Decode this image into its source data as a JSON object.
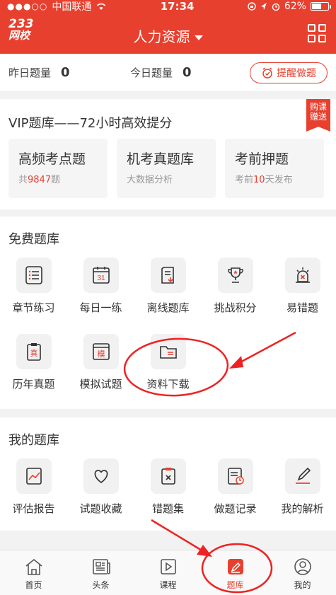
{
  "status_bar": {
    "signal": "●●●○○",
    "carrier": "中国联通",
    "time": "17:34",
    "battery": "62%",
    "battery_level": 0.62
  },
  "header": {
    "logo_num": "233",
    "logo_text": "网校",
    "title": "人力资源"
  },
  "stats": {
    "yesterday_label": "昨日题量",
    "yesterday_value": "0",
    "today_label": "今日题量",
    "today_value": "0",
    "remind_label": "提醒做题"
  },
  "vip": {
    "title": "VIP题库——72小时高效提分",
    "badge_line1": "购课",
    "badge_line2": "赠送",
    "cards": [
      {
        "title": "高频考点题",
        "sub_prefix": "共",
        "sub_highlight": "9847",
        "sub_suffix": "题"
      },
      {
        "title": "机考真题库",
        "sub_prefix": "大数据分析",
        "sub_highlight": "",
        "sub_suffix": ""
      },
      {
        "title": "考前押题",
        "sub_prefix": "考前",
        "sub_highlight": "10",
        "sub_suffix": "天发布"
      }
    ]
  },
  "free_bank": {
    "title": "免费题库",
    "items": [
      {
        "label": "章节练习",
        "icon": "list-icon"
      },
      {
        "label": "每日一练",
        "icon": "calendar-icon",
        "icon_text": "31"
      },
      {
        "label": "离线题库",
        "icon": "download-doc-icon"
      },
      {
        "label": "挑战积分",
        "icon": "trophy-icon"
      },
      {
        "label": "易错题",
        "icon": "alarm-icon"
      },
      {
        "label": "历年真题",
        "icon": "clipboard-icon",
        "icon_text": "真"
      },
      {
        "label": "模拟试题",
        "icon": "browser-icon",
        "icon_text": "模"
      },
      {
        "label": "资料下载",
        "icon": "folder-icon"
      }
    ]
  },
  "my_bank": {
    "title": "我的题库",
    "items": [
      {
        "label": "评估报告",
        "icon": "chart-doc-icon"
      },
      {
        "label": "试题收藏",
        "icon": "heart-icon"
      },
      {
        "label": "错题集",
        "icon": "wrong-doc-icon"
      },
      {
        "label": "做题记录",
        "icon": "record-icon"
      },
      {
        "label": "我的解析",
        "icon": "edit-icon"
      }
    ]
  },
  "tabbar": [
    {
      "label": "首页",
      "icon": "home-icon"
    },
    {
      "label": "头条",
      "icon": "news-icon"
    },
    {
      "label": "课程",
      "icon": "play-icon"
    },
    {
      "label": "题库",
      "icon": "pen-icon"
    },
    {
      "label": "我的",
      "icon": "user-icon"
    }
  ],
  "colors": {
    "brand": "#e8402f"
  }
}
